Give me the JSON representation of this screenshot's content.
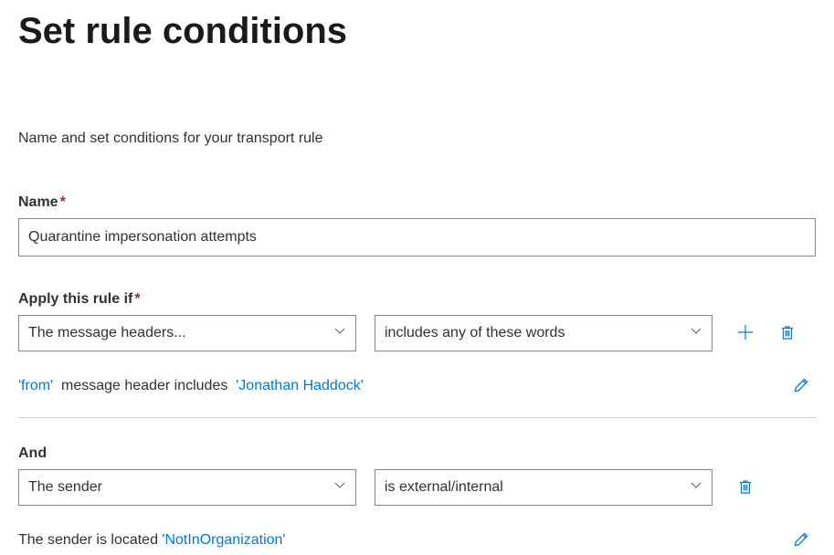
{
  "page": {
    "title": "Set rule conditions",
    "description": "Name and set conditions for your transport rule"
  },
  "nameField": {
    "label": "Name",
    "value": "Quarantine impersonation attempts"
  },
  "condition1": {
    "label": "Apply this rule if",
    "dropdown1": "The message headers...",
    "dropdown2": "includes any of these words",
    "summary": {
      "part1": "'from'",
      "part2": "  message header includes  ",
      "part3": "'Jonathan Haddock'"
    }
  },
  "condition2": {
    "label": "And",
    "dropdown1": "The sender",
    "dropdown2": "is external/internal",
    "summary": {
      "part1": "The sender is located ",
      "part2": "'NotInOrganization'"
    }
  },
  "colors": {
    "accent": "#0078d4",
    "required": "#a4262c"
  }
}
